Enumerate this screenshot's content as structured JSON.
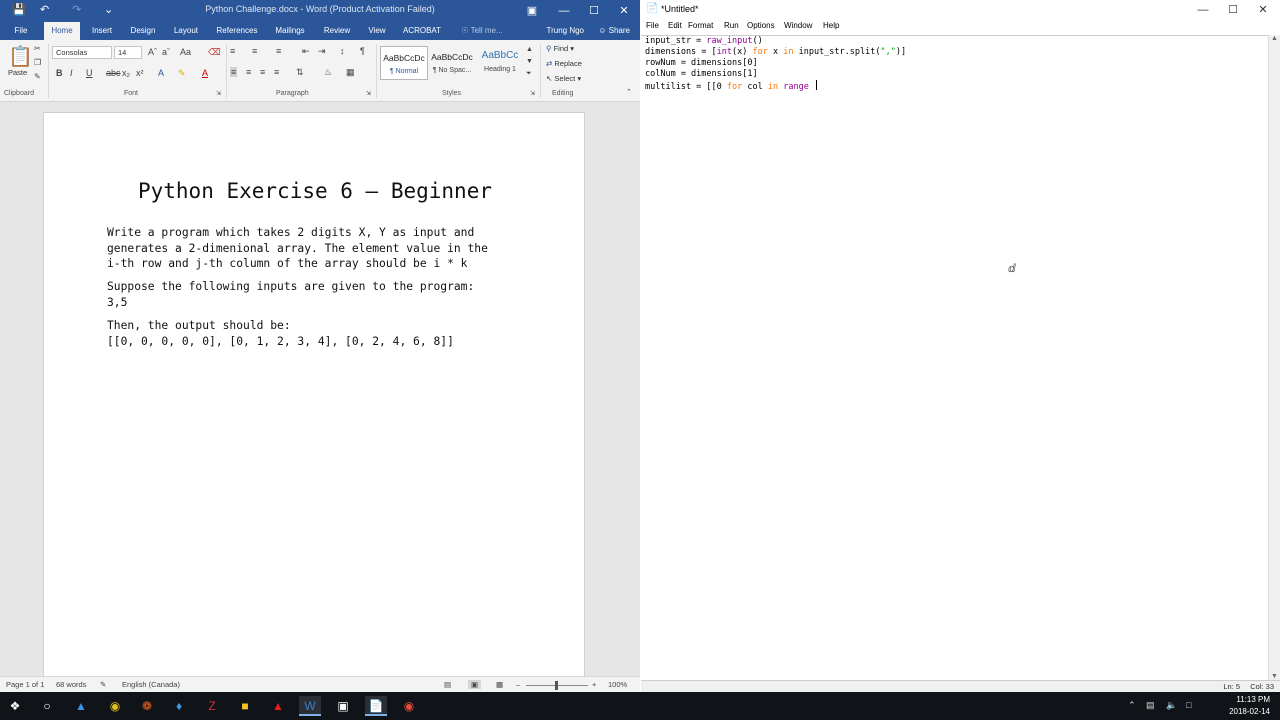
{
  "word": {
    "title": "Python Challenge.docx - Word (Product Activation Failed)",
    "tabs": [
      "File",
      "Home",
      "Insert",
      "Design",
      "Layout",
      "References",
      "Mailings",
      "Review",
      "View",
      "ACROBAT"
    ],
    "tell_me": "Tell me...",
    "user": "Trung Ngo",
    "share": "Share",
    "font_name": "Consolas",
    "font_size": "14",
    "paste_label": "Paste",
    "groups": {
      "clipboard": "Clipboard",
      "font": "Font",
      "paragraph": "Paragraph",
      "styles": "Styles",
      "editing": "Editing"
    },
    "styles": [
      {
        "preview": "AaBbCcDc",
        "name": "¶ Normal"
      },
      {
        "preview": "AaBbCcDc",
        "name": "¶ No Spac..."
      },
      {
        "preview": "AaBbCc",
        "name": "Heading 1"
      }
    ],
    "editing": {
      "find": "Find",
      "replace": "Replace",
      "select": "Select"
    },
    "document": {
      "title": "Python Exercise 6 – Beginner",
      "para1": "Write a program which takes 2 digits X, Y as input and\ngenerates a 2-dimenional array. The element value in the\ni-th row and j-th column of the array should be i * k",
      "para2": "Suppose the following inputs are given to the program:\n3,5",
      "para3": "Then, the output should be:\n[[0, 0, 0, 0, 0], [0, 1, 2, 3, 4], [0, 2, 4, 6, 8]]"
    },
    "status": {
      "page": "Page 1 of 1",
      "words": "68 words",
      "language": "English (Canada)",
      "zoom": "100%"
    }
  },
  "idle": {
    "title": "*Untitled*",
    "menu": [
      "File",
      "Edit",
      "Format",
      "Run",
      "Options",
      "Window",
      "Help"
    ],
    "code": {
      "l1a": "input_str = ",
      "l1b": "raw_input",
      "l1c": "()",
      "l2a": "dimensions = [",
      "l2b": "int",
      "l2c": "(x) ",
      "l2d": "for",
      "l2e": " x ",
      "l2f": "in",
      "l2g": " input_str.split(",
      "l2h": "\",\"",
      "l2i": ")]",
      "l3": "rowNum = dimensions[0]",
      "l4": "colNum = dimensions[1]",
      "l5a": "multilist = [[0 ",
      "l5b": "for",
      "l5c": " col ",
      "l5d": "in",
      "l5e": " ",
      "l5f": "range",
      "l5g": " "
    },
    "status": {
      "ln": "Ln: 5",
      "col": "Col: 33"
    }
  },
  "taskbar": {
    "time": "11:13 PM",
    "date": "2018-02-14"
  }
}
